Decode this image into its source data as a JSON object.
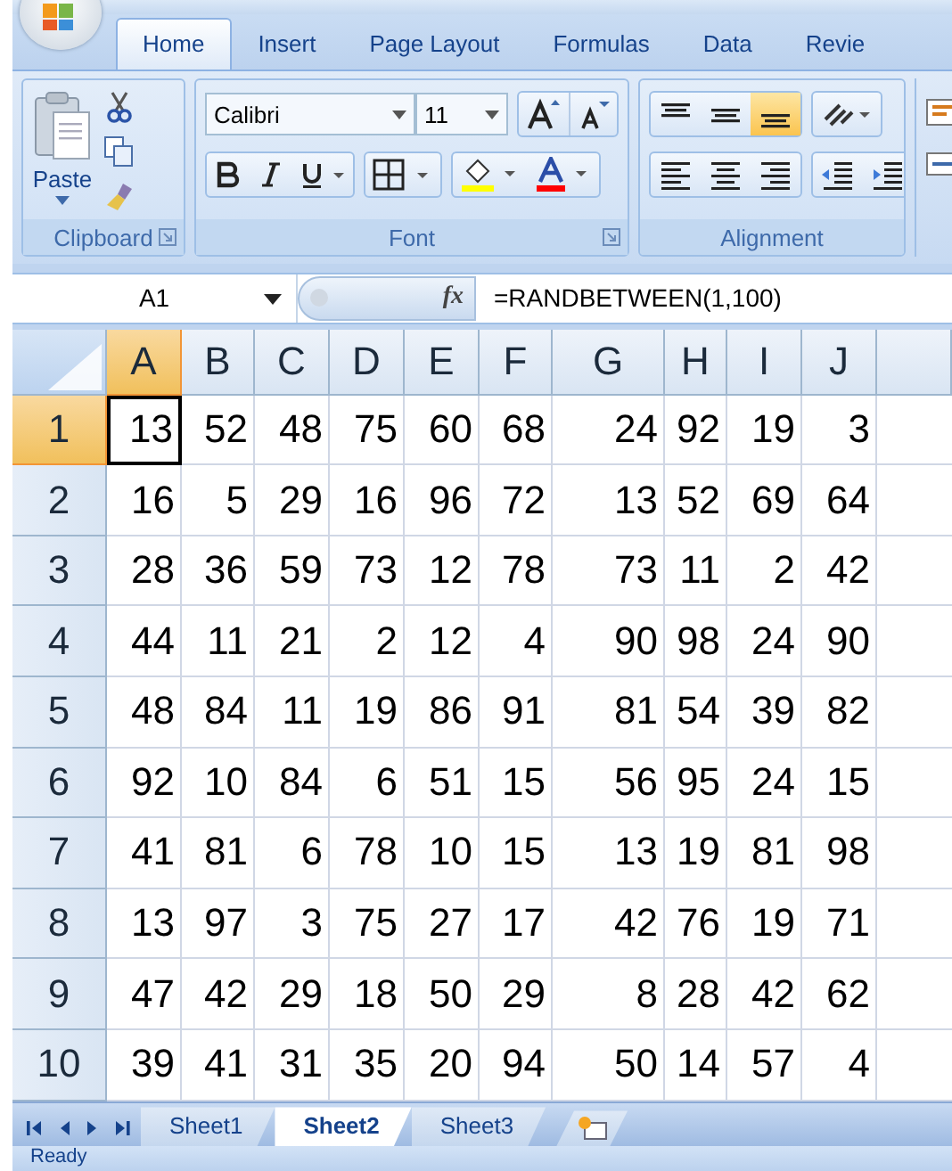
{
  "ribbon_tabs": [
    {
      "label": "Home",
      "selected": true
    },
    {
      "label": "Insert",
      "selected": false
    },
    {
      "label": "Page Layout",
      "selected": false
    },
    {
      "label": "Formulas",
      "selected": false
    },
    {
      "label": "Data",
      "selected": false
    },
    {
      "label": "Revie",
      "selected": false
    }
  ],
  "clipboard": {
    "label": "Clipboard",
    "paste_label": "Paste"
  },
  "font": {
    "label": "Font",
    "font_name": "Calibri",
    "font_size": "11"
  },
  "alignment": {
    "label": "Alignment",
    "vertical_buttons": [
      {
        "kind": "top",
        "selected": false
      },
      {
        "kind": "middle",
        "selected": false
      },
      {
        "kind": "bottom",
        "selected": true
      }
    ]
  },
  "name_box": "A1",
  "function_label": "fx",
  "formula": "=RANDBETWEEN(1,100)",
  "columns": [
    {
      "label": "A",
      "selected": true
    },
    {
      "label": "B",
      "selected": false
    },
    {
      "label": "C",
      "selected": false
    },
    {
      "label": "D",
      "selected": false
    },
    {
      "label": "E",
      "selected": false
    },
    {
      "label": "F",
      "selected": false
    },
    {
      "label": "G",
      "selected": false
    },
    {
      "label": "H",
      "selected": false
    },
    {
      "label": "I",
      "selected": false
    },
    {
      "label": "J",
      "selected": false
    }
  ],
  "rows": [
    {
      "header": "1",
      "selected": true,
      "cells": [
        "13",
        "52",
        "48",
        "75",
        "60",
        "68",
        "24",
        "92",
        "19",
        "3"
      ]
    },
    {
      "header": "2",
      "selected": false,
      "cells": [
        "16",
        "5",
        "29",
        "16",
        "96",
        "72",
        "13",
        "52",
        "69",
        "64"
      ]
    },
    {
      "header": "3",
      "selected": false,
      "cells": [
        "28",
        "36",
        "59",
        "73",
        "12",
        "78",
        "73",
        "11",
        "2",
        "42"
      ]
    },
    {
      "header": "4",
      "selected": false,
      "cells": [
        "44",
        "11",
        "21",
        "2",
        "12",
        "4",
        "90",
        "98",
        "24",
        "90"
      ]
    },
    {
      "header": "5",
      "selected": false,
      "cells": [
        "48",
        "84",
        "11",
        "19",
        "86",
        "91",
        "81",
        "54",
        "39",
        "82"
      ]
    },
    {
      "header": "6",
      "selected": false,
      "cells": [
        "92",
        "10",
        "84",
        "6",
        "51",
        "15",
        "56",
        "95",
        "24",
        "15"
      ]
    },
    {
      "header": "7",
      "selected": false,
      "cells": [
        "41",
        "81",
        "6",
        "78",
        "10",
        "15",
        "13",
        "19",
        "81",
        "98"
      ]
    },
    {
      "header": "8",
      "selected": false,
      "cells": [
        "13",
        "97",
        "3",
        "75",
        "27",
        "17",
        "42",
        "76",
        "19",
        "71"
      ]
    },
    {
      "header": "9",
      "selected": false,
      "cells": [
        "47",
        "42",
        "29",
        "18",
        "50",
        "29",
        "8",
        "28",
        "42",
        "62"
      ]
    },
    {
      "header": "10",
      "selected": false,
      "cells": [
        "39",
        "41",
        "31",
        "35",
        "20",
        "94",
        "50",
        "14",
        "57",
        "4"
      ]
    }
  ],
  "sheet_tabs": [
    {
      "label": "Sheet1",
      "selected": false
    },
    {
      "label": "Sheet2",
      "selected": true
    },
    {
      "label": "Sheet3",
      "selected": false
    }
  ],
  "status": "Ready"
}
